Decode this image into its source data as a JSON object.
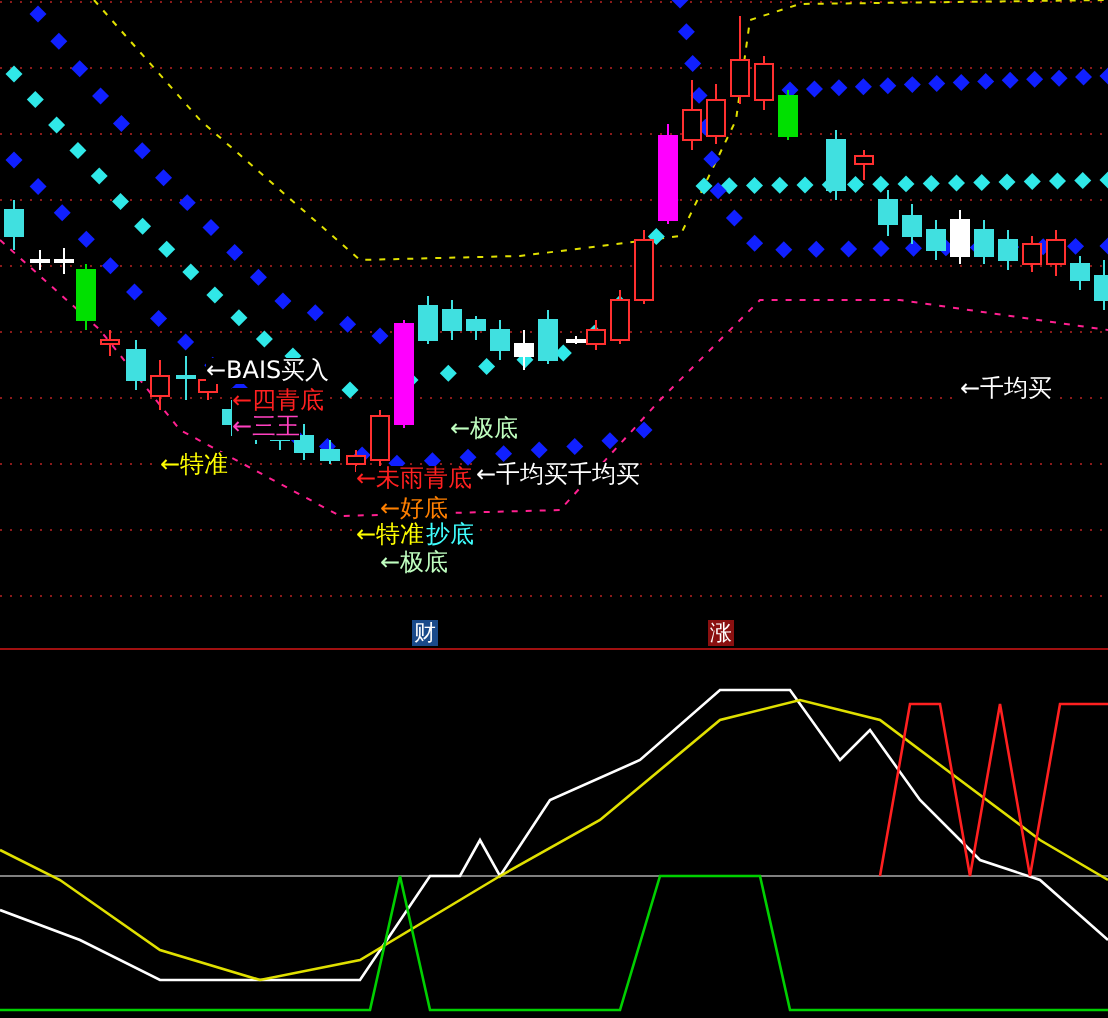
{
  "main_chart": {
    "signals": [
      {
        "text": "←BAIS买入",
        "color": "#ffffff"
      },
      {
        "text": "←四青底",
        "color": "#ff2020"
      },
      {
        "text": "←三王",
        "color": "#ff40c0"
      },
      {
        "text": "←特准",
        "color": "#ffff00"
      },
      {
        "text": "←极底",
        "color": "#c0ffc0"
      },
      {
        "text": "←未雨青底",
        "color": "#ff2020"
      },
      {
        "text": "←千均买千均买",
        "color": "#ffffff"
      },
      {
        "text": "←千均买",
        "color": "#ffffff"
      },
      {
        "text": "←好底",
        "color": "#ff8000"
      },
      {
        "text": "←特准",
        "color": "#ffff00"
      },
      {
        "text": "抄底",
        "color": "#40ffff"
      },
      {
        "text": "←极底",
        "color": "#c0ffc0"
      }
    ]
  },
  "badges": [
    {
      "text": "财",
      "color": "#1a4a8a"
    },
    {
      "text": "涨",
      "color": "#8a1010"
    }
  ]
}
